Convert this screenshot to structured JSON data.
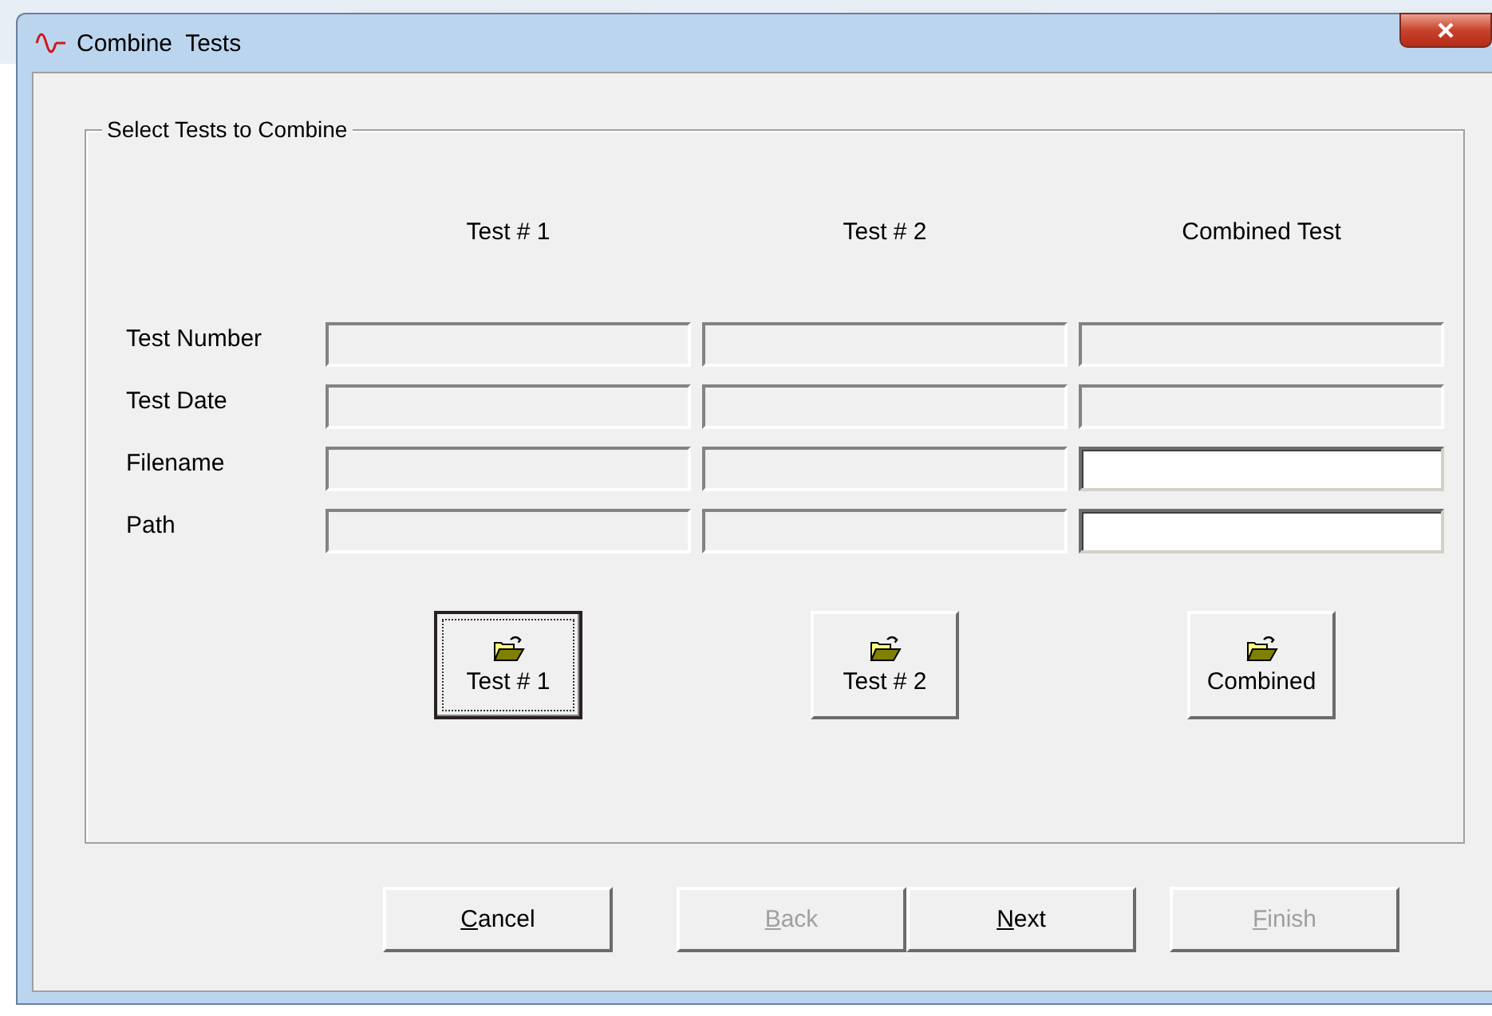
{
  "window": {
    "title": "Combine  Tests"
  },
  "group": {
    "title": "Select Tests to Combine",
    "columns": [
      "Test # 1",
      "Test # 2",
      "Combined Test"
    ],
    "rows": [
      {
        "label": "Test Number",
        "fields": [
          {
            "editable": false
          },
          {
            "editable": false
          },
          {
            "editable": false
          }
        ]
      },
      {
        "label": "Test Date",
        "fields": [
          {
            "editable": false
          },
          {
            "editable": false
          },
          {
            "editable": false
          }
        ]
      },
      {
        "label": "Filename",
        "fields": [
          {
            "editable": false
          },
          {
            "editable": false
          },
          {
            "editable": true
          }
        ]
      },
      {
        "label": "Path",
        "fields": [
          {
            "editable": false
          },
          {
            "editable": false
          },
          {
            "editable": true
          }
        ]
      }
    ],
    "open_buttons": [
      {
        "label": "Test # 1",
        "focused": true
      },
      {
        "label": "Test # 2",
        "focused": false
      },
      {
        "label": "Combined",
        "focused": false
      }
    ]
  },
  "buttons": [
    {
      "label": "Cancel",
      "disabled": false
    },
    {
      "label": "Back",
      "disabled": true
    },
    {
      "label": "Next",
      "disabled": false
    },
    {
      "label": "Finish",
      "disabled": true
    }
  ]
}
